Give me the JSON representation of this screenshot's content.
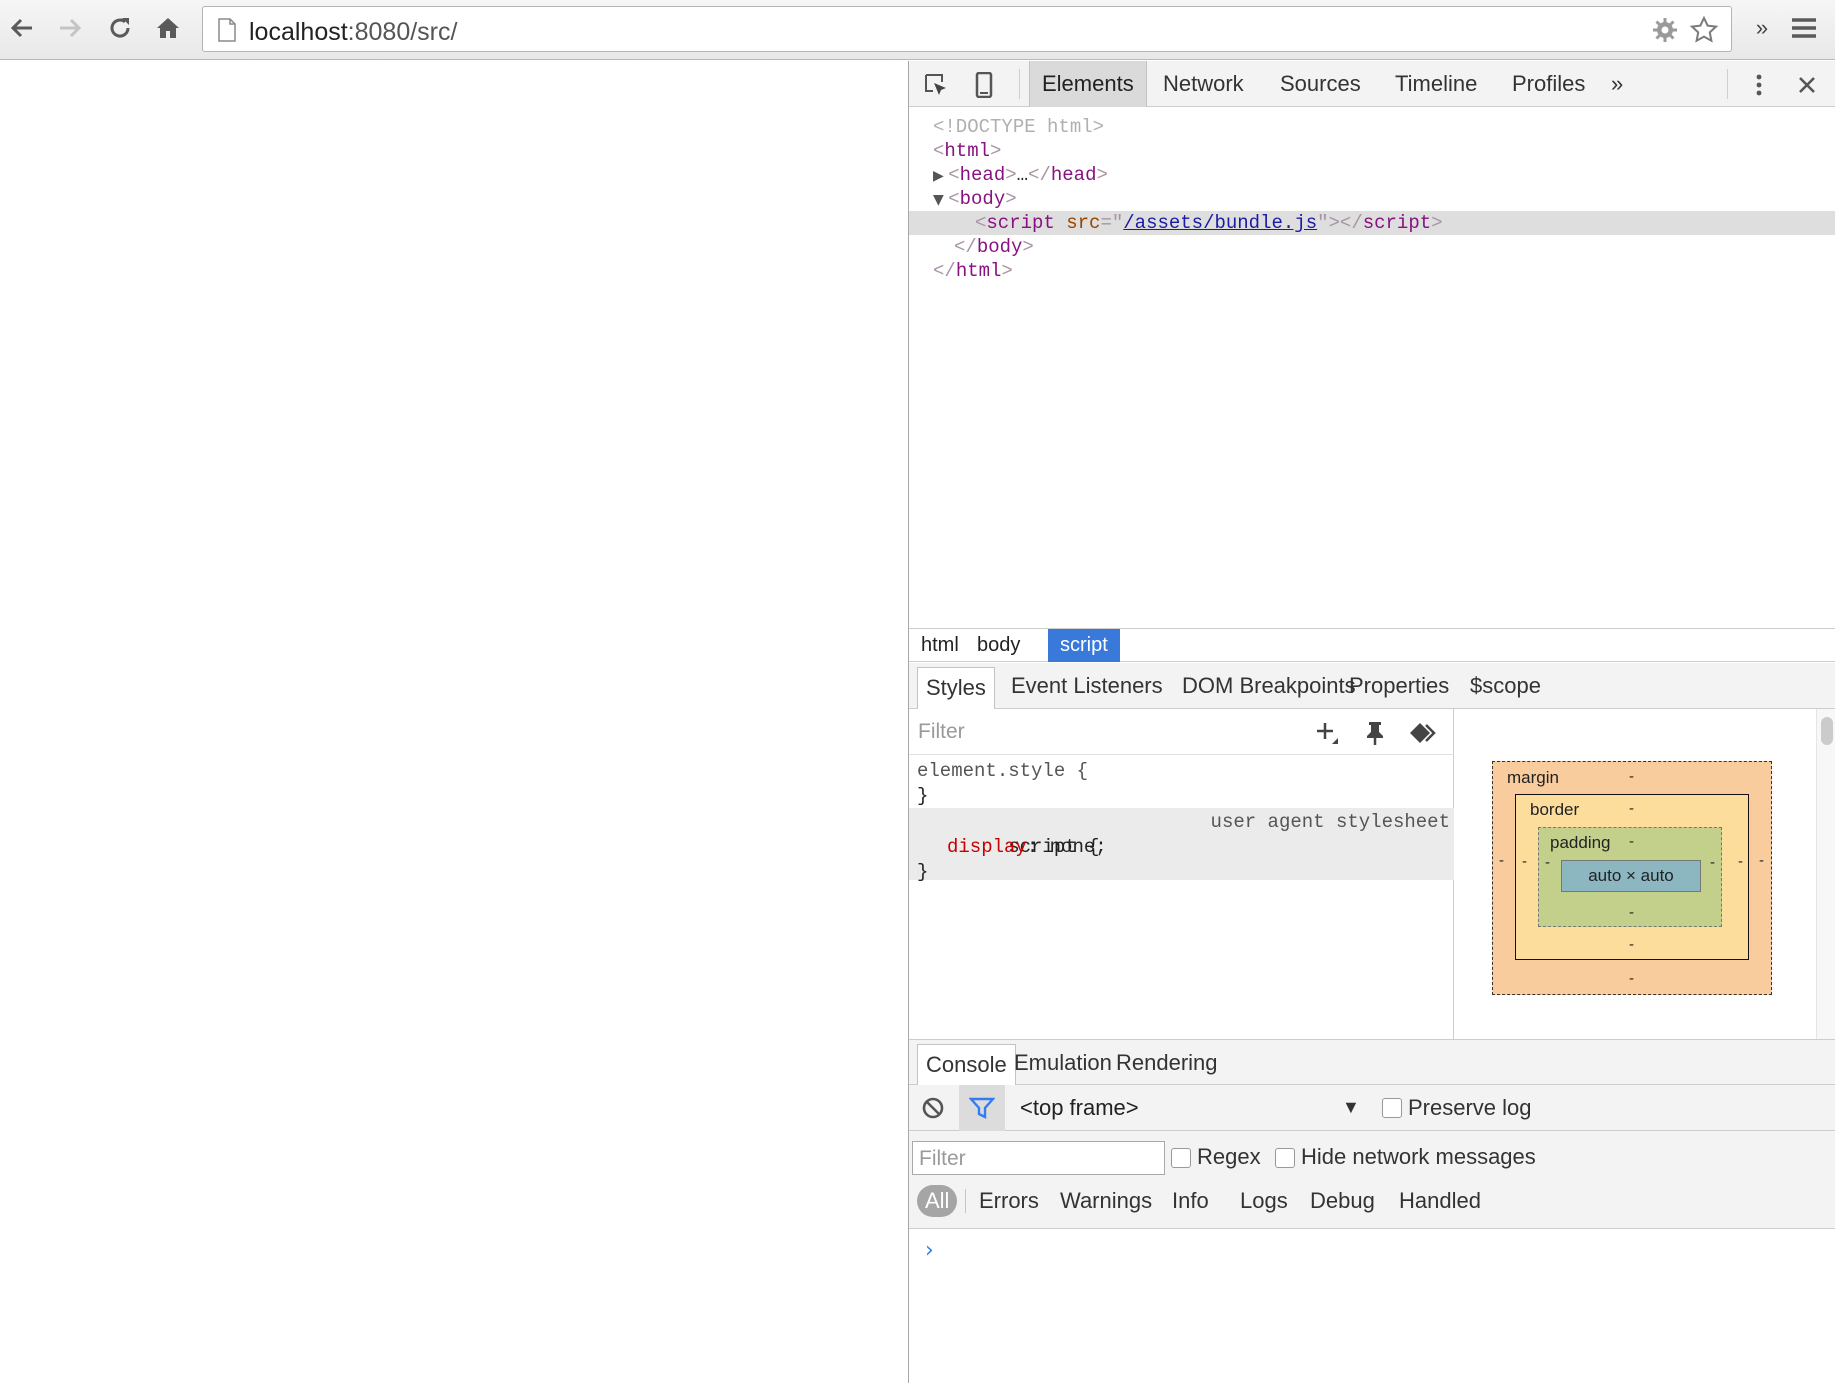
{
  "browser": {
    "url_host": "localhost",
    "url_rest": ":8080/src/",
    "overflow_label": "»"
  },
  "devtools": {
    "tabs": [
      "Elements",
      "Network",
      "Sources",
      "Timeline",
      "Profiles"
    ],
    "more_tabs": "»",
    "dom": {
      "doctype": "<!DOCTYPE html>",
      "html_open": "html",
      "head": "head",
      "head_ellipsis": "…",
      "body": "body",
      "script_tag": "script",
      "script_attr": "src",
      "script_src": "/assets/bundle.js"
    },
    "breadcrumbs": [
      "html",
      "body",
      "script"
    ],
    "sub_tabs": [
      "Styles",
      "Event Listeners",
      "DOM Breakpoints",
      "Properties",
      "$scope"
    ],
    "styles": {
      "filter_placeholder": "Filter",
      "element_style_selector": "element.style {",
      "close_brace": "}",
      "script_selector": "script {",
      "origin": "user agent stylesheet",
      "prop_name": "display",
      "prop_value": " none;"
    },
    "box_model": {
      "margin_label": "margin",
      "border_label": "border",
      "padding_label": "padding",
      "content": "auto × auto",
      "dash": "-"
    },
    "drawer_tabs": [
      "Console",
      "Emulation",
      "Rendering"
    ],
    "console": {
      "frame": "<top frame>",
      "preserve_log": "Preserve log",
      "filter_placeholder": "Filter",
      "regex": "Regex",
      "hide_network": "Hide network messages",
      "levels": [
        "All",
        "Errors",
        "Warnings",
        "Info",
        "Logs",
        "Debug",
        "Handled"
      ],
      "prompt": "›"
    }
  },
  "colors": {
    "selected_crumb": "#3879d9",
    "tag": "#881280",
    "attr_name": "#994500",
    "attr_value": "#1a1aa6",
    "css_prop": "#c80000",
    "margin": "#f9cc9d",
    "border": "#fddd9b",
    "padding": "#c3d08b",
    "content": "#8cb6c0"
  }
}
